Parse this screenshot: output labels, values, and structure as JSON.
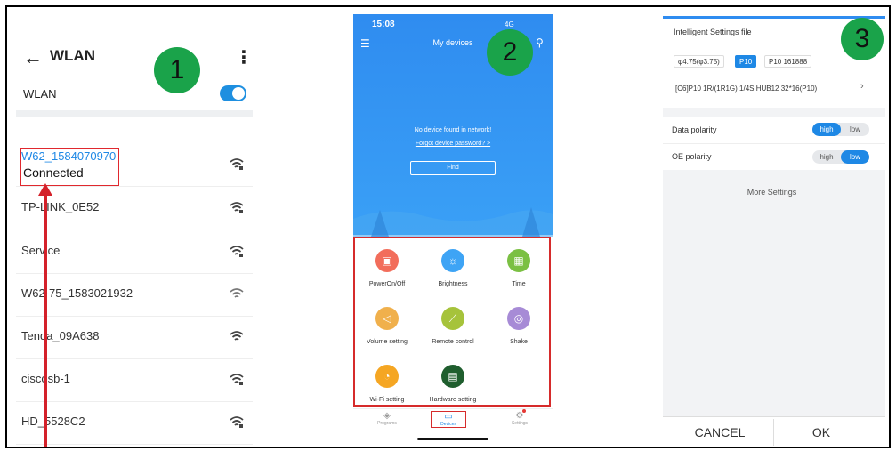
{
  "panel1": {
    "back_icon": "arrow-left-icon",
    "title": "WLAN",
    "more_icon": "more-vertical-icon",
    "wlan_label": "WLAN",
    "wlan_enabled": true,
    "badge": "1",
    "networks": [
      {
        "name": "W62_1584070970",
        "status": "Connected"
      },
      {
        "name": "TP-LINK_0E52"
      },
      {
        "name": "Service"
      },
      {
        "name": "W62-75_1583021932"
      },
      {
        "name": "Tenda_09A638"
      },
      {
        "name": "ciscosb-1"
      },
      {
        "name": "HD_5528C2"
      }
    ],
    "colors": {
      "accent": "#1e88e5",
      "highlight": "#e0282e",
      "badge": "#1aa34a"
    }
  },
  "panel2": {
    "status_time": "15:08",
    "status_net": "4G",
    "title": "My devices",
    "badge": "2",
    "no_device": "No device found in network!",
    "forgot": "Forgot device password? >",
    "find_button": "Find",
    "tiles": [
      {
        "label": "PowerOn/Off",
        "icon": "power-icon",
        "color": "#f26d5b"
      },
      {
        "label": "Brightness",
        "icon": "brightness-icon",
        "color": "#3ea4f5"
      },
      {
        "label": "Time",
        "icon": "calendar-icon",
        "color": "#7bc043"
      },
      {
        "label": "Volume setting",
        "icon": "volume-icon",
        "color": "#f0b04c"
      },
      {
        "label": "Remote control",
        "icon": "remote-icon",
        "color": "#a6c33b"
      },
      {
        "label": "Shake",
        "icon": "shake-icon",
        "color": "#a78bd6"
      },
      {
        "label": "Wi-Fi setting",
        "icon": "wifi-icon",
        "color": "#f5a623"
      },
      {
        "label": "Hardware setting",
        "icon": "chip-icon",
        "color": "#1f5e2e"
      }
    ],
    "tabs": [
      {
        "label": "Programs",
        "icon": "programs-icon"
      },
      {
        "label": "Devices",
        "icon": "devices-icon"
      },
      {
        "label": "Settings",
        "icon": "settings-icon"
      }
    ]
  },
  "panel3": {
    "header": "Intelligent Settings file",
    "badge": "3",
    "chips": [
      "φ4.75(φ3.75)",
      "P10",
      "P10 161888"
    ],
    "selected_chip": "P10",
    "model": "[C6]P10 1R/(1R1G) 1/4S HUB12 32*16(P10)",
    "data_polarity": {
      "label": "Data polarity",
      "options": [
        "high",
        "low"
      ],
      "selected": "high"
    },
    "oe_polarity": {
      "label": "OE polarity",
      "options": [
        "high",
        "low"
      ],
      "selected": "low"
    },
    "more_settings": "More Settings",
    "cancel": "CANCEL",
    "ok": "OK"
  }
}
